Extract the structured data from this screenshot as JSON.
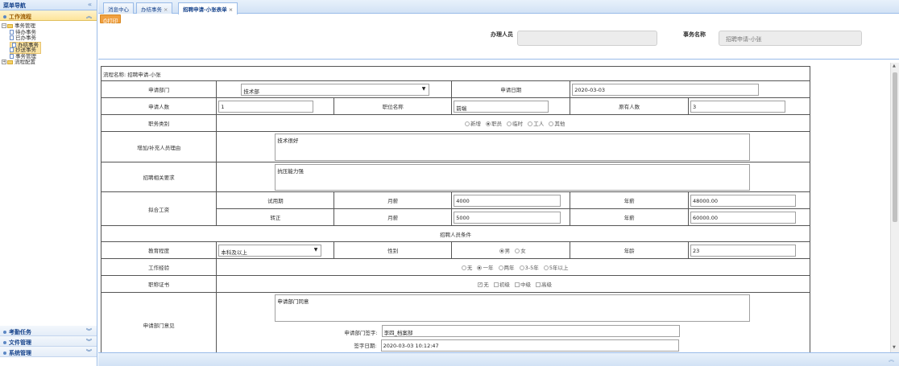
{
  "sidebar": {
    "title": "菜单导航",
    "sections": [
      {
        "label": "工作流程",
        "active": true
      },
      {
        "label": "考勤任务"
      },
      {
        "label": "文件管理"
      },
      {
        "label": "系统管理"
      }
    ],
    "tree": {
      "root": "事务管理",
      "children": [
        "待办事务",
        "已办事务",
        "办结事务",
        "抄送事务",
        "事务管理"
      ],
      "selected": "办结事务",
      "second_root": "流程配置"
    }
  },
  "tabs": [
    {
      "label": "消息中心"
    },
    {
      "label": "办结事务",
      "closable": true
    },
    {
      "label": "招聘申请-小张表单",
      "closable": true,
      "active": true
    }
  ],
  "toolbar": {
    "print_label": "打印"
  },
  "header_form": {
    "handler_label": "办理人员",
    "handler_value": "",
    "title_label": "事务名称",
    "title_value": "招聘申请-小张"
  },
  "form": {
    "flow_name": "流程名称: 招聘申请-小张",
    "dept_label": "申请部门",
    "dept_value": "技术部",
    "date_label": "申请日期",
    "date_value": "2020-03-03",
    "count_label": "申请人数",
    "count_value": "1",
    "position_label": "职位名称",
    "position_value": "前端",
    "existing_label": "原有人数",
    "existing_value": "3",
    "jobtype_label": "职务类别",
    "jobtype_options": [
      "新增",
      "职员",
      "临时",
      "工人",
      "其他"
    ],
    "jobtype_selected": "职员",
    "reason_label": "增加/补充人员理由",
    "reason_value": "技术很好",
    "require_label": "招聘相关要求",
    "require_value": "抗压能力强",
    "salary_label": "拟合工资",
    "trial_label": "试用期",
    "monthly_label": "月薪",
    "annual_label": "年薪",
    "trial_monthly": "4000",
    "trial_annual": "48000.00",
    "formal_label": "转正",
    "formal_monthly": "5000",
    "formal_annual": "60000.00",
    "conditions_label": "招聘人员条件",
    "edu_label": "教育程度",
    "edu_value": "本科及以上",
    "gender_label": "性别",
    "gender_options": [
      "男",
      "女"
    ],
    "gender_selected": "男",
    "age_label": "年龄",
    "age_value": "23",
    "exp_label": "工作经验",
    "exp_options": [
      "无",
      "一年",
      "两年",
      "3-5年",
      "5年以上"
    ],
    "exp_selected": "一年",
    "cert_label": "职称证书",
    "cert_options": [
      "无",
      "初级",
      "中级",
      "高级"
    ],
    "cert_checked": "无",
    "opinion_label": "申请部门意见",
    "opinion_value": "申请部门同意",
    "sign_label": "申请部门签字:",
    "sign_value": "李四_档案部",
    "signdate_label": "签字日期:",
    "signdate_value": "2020-03-03 10:12:47"
  },
  "colors": {
    "accent": "#f0a040",
    "border": "#99bbe8",
    "header_text": "#15428b"
  }
}
